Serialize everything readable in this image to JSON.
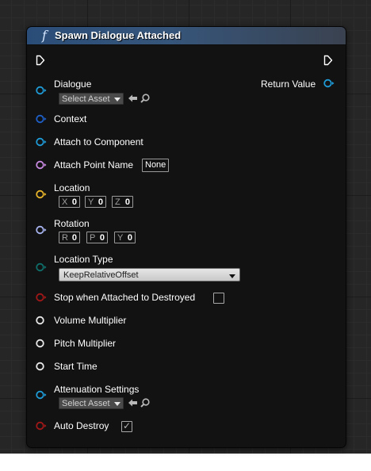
{
  "node": {
    "title": "Spawn Dialogue Attached",
    "icon": "function-icon",
    "icon_glyph": "f",
    "header_color": "#2a4d78"
  },
  "pins": {
    "dialogue": {
      "label": "Dialogue",
      "color": "#1e9bd7",
      "asset_value": "Select Asset"
    },
    "return_value": {
      "label": "Return Value",
      "color": "#1e9bd7"
    },
    "context": {
      "label": "Context",
      "color": "#1e5fc8"
    },
    "attach_to_component": {
      "label": "Attach to Component",
      "color": "#1e9bd7"
    },
    "attach_point_name": {
      "label": "Attach Point Name",
      "color": "#c88ae0",
      "value": "None"
    },
    "location": {
      "label": "Location",
      "color": "#e8b42a",
      "x_axis": "X",
      "x": "0",
      "y_axis": "Y",
      "y": "0",
      "z_axis": "Z",
      "z": "0"
    },
    "rotation": {
      "label": "Rotation",
      "color": "#a8b4f0",
      "r_axis": "R",
      "r": "0",
      "p_axis": "P",
      "p": "0",
      "y_axis": "Y",
      "y": "0"
    },
    "location_type": {
      "label": "Location Type",
      "color": "#0f6e6a",
      "value": "KeepRelativeOffset"
    },
    "stop_when_destroyed": {
      "label": "Stop when Attached to Destroyed",
      "color": "#a01818",
      "checked": false
    },
    "volume_multiplier": {
      "label": "Volume Multiplier",
      "color": "#e8e8e8"
    },
    "pitch_multiplier": {
      "label": "Pitch Multiplier",
      "color": "#e8e8e8"
    },
    "start_time": {
      "label": "Start Time",
      "color": "#e8e8e8"
    },
    "attenuation_settings": {
      "label": "Attenuation Settings",
      "color": "#1e9bd7",
      "asset_value": "Select Asset"
    },
    "auto_destroy": {
      "label": "Auto Destroy",
      "color": "#a01818",
      "checked": true
    }
  },
  "icons": {
    "exec_in": "exec-input-pin-icon",
    "exec_out": "exec-output-pin-icon",
    "use_selected": "arrow-left-icon",
    "browse": "magnifier-icon"
  }
}
